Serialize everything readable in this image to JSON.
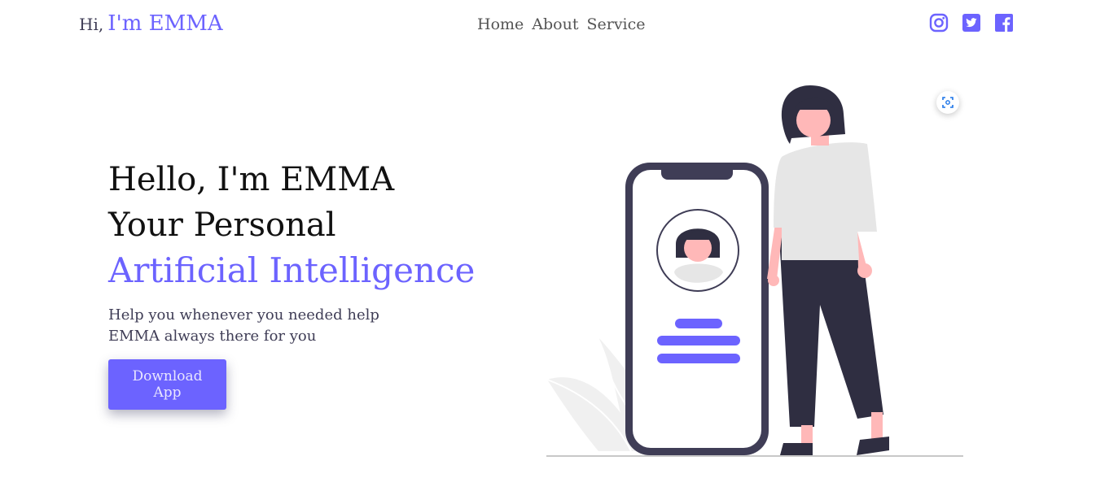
{
  "header": {
    "brand_prefix": "Hi,",
    "brand_name": "I'm EMMA",
    "nav": [
      {
        "label": "Home"
      },
      {
        "label": "About"
      },
      {
        "label": "Service"
      }
    ],
    "social": [
      "instagram-icon",
      "twitter-icon",
      "facebook-icon"
    ]
  },
  "hero": {
    "line1": "Hello, I'm EMMA",
    "line2": "Your Personal",
    "line3": "Artificial Intelligence",
    "sub1": "Help you whenever you needed help",
    "sub2": "EMMA always there for you",
    "cta_label": "Download App"
  },
  "colors": {
    "accent": "#6c63ff",
    "dark": "#3f3d56",
    "skin": "#ffb8b8"
  }
}
